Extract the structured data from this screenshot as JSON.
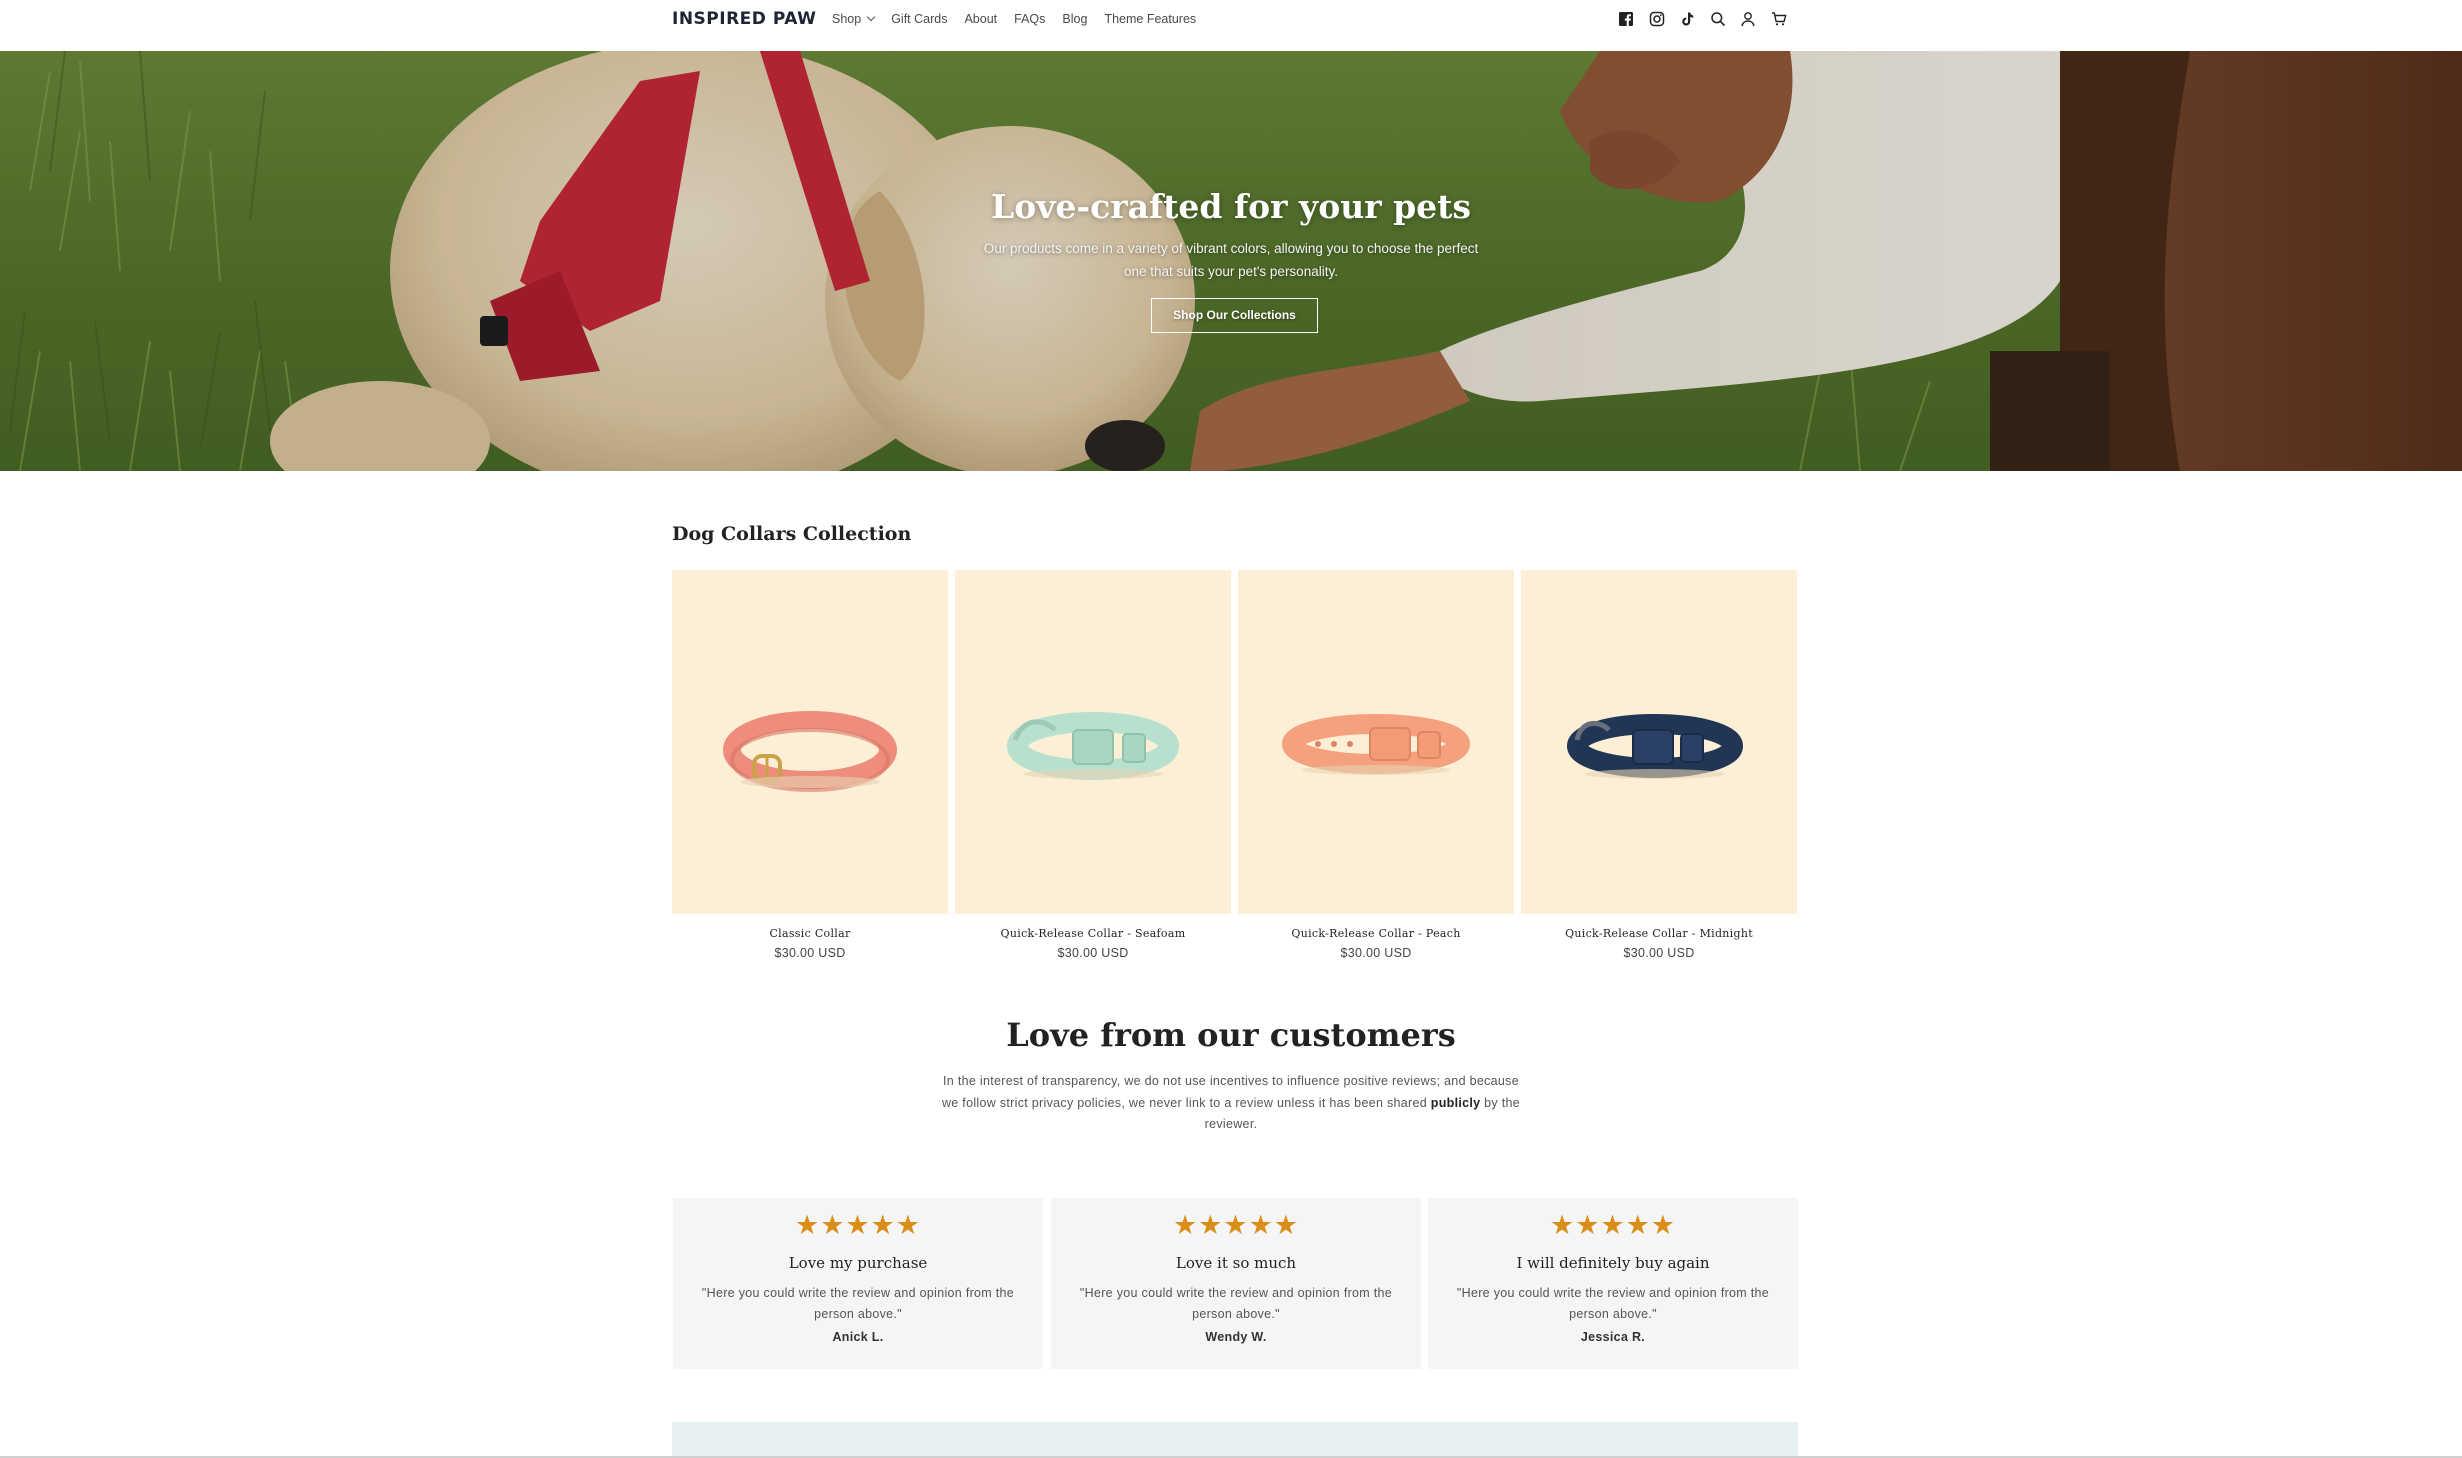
{
  "header": {
    "logo": "INSPIRED PAW",
    "nav": [
      {
        "label": "Shop",
        "has_dropdown": true
      },
      {
        "label": "Gift Cards"
      },
      {
        "label": "About"
      },
      {
        "label": "FAQs"
      },
      {
        "label": "Blog"
      },
      {
        "label": "Theme Features"
      }
    ],
    "icons": [
      "facebook-icon",
      "instagram-icon",
      "tiktok-icon",
      "search-icon",
      "account-icon",
      "cart-icon"
    ]
  },
  "hero": {
    "title": "Love-crafted for your pets",
    "subtitle": "Our products come in a variety of vibrant colors, allowing you to choose the perfect one that suits your pet's personality.",
    "button_label": "Shop Our Collections"
  },
  "collection": {
    "title": "Dog Collars Collection",
    "products": [
      {
        "name": "Classic Collar",
        "price": "$30.00 USD",
        "color": "#ee8d7c"
      },
      {
        "name": "Quick-Release Collar - Seafoam",
        "price": "$30.00 USD",
        "color": "#b8e0cf"
      },
      {
        "name": "Quick-Release Collar - Peach",
        "price": "$30.00 USD",
        "color": "#f5a17e"
      },
      {
        "name": "Quick-Release Collar - Midnight",
        "price": "$30.00 USD",
        "color": "#213555"
      }
    ]
  },
  "reviews": {
    "title": "Love from our customers",
    "intro_before": "In the interest of transparency, we do not use incentives to influence positive reviews; and because we follow strict privacy policies, we never link to a review unless it has been shared ",
    "intro_bold": "publicly",
    "intro_after": " by the reviewer.",
    "items": [
      {
        "stars": "★★★★★",
        "title": "Love my purchase",
        "text": "\"Here you could write the review and opinion from the person above.\"",
        "author": "Anick L."
      },
      {
        "stars": "★★★★★",
        "title": "Love it so much",
        "text": "\"Here you could write the review and opinion from the person above.\"",
        "author": "Wendy W."
      },
      {
        "stars": "★★★★★",
        "title": "I will definitely buy again",
        "text": "\"Here you could write the review and opinion from the person above.\"",
        "author": "Jessica R."
      }
    ]
  },
  "colors": {
    "star": "#d98e1a",
    "card_bg": "#fdeed6",
    "review_bg": "#f5f5f5",
    "banner_bg": "#e7f1f3"
  }
}
